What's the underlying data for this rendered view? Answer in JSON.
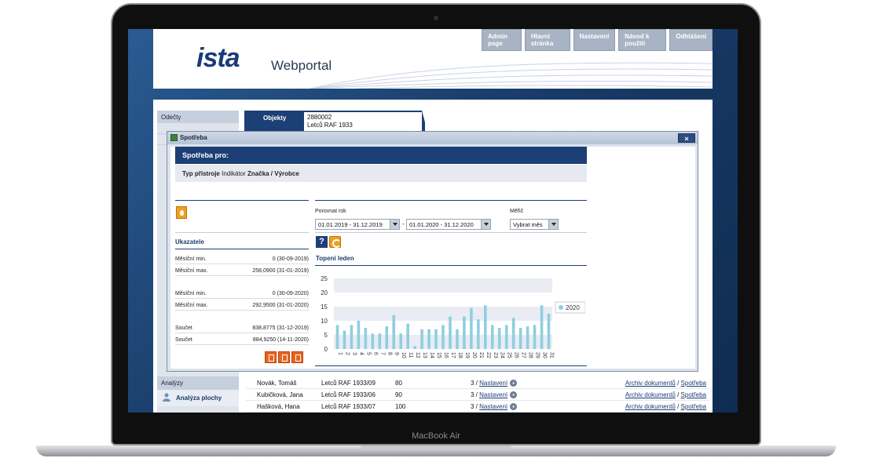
{
  "device": {
    "brand": "MacBook Air"
  },
  "header": {
    "logo_main": "ista",
    "app_title": "Webportal",
    "nav": [
      "Admin page",
      "Hlavní stránka",
      "Nastavení",
      "Návod k použití",
      "Odhlášení"
    ]
  },
  "sidebar": {
    "title": "Odečty",
    "section_analyzy": "Analýzy",
    "analyza_plochy": "Analýza plochy"
  },
  "objekty": {
    "label": "Objekty",
    "id": "2880002",
    "address": "Letců RAF 1933"
  },
  "bg_table": {
    "rows": [
      {
        "name": "Novák, Tomáš",
        "object": "Letců RAF 1933/09",
        "num": "80",
        "count": "3 / ",
        "settings": "Nastavení",
        "docs": "Archiv dokumentů",
        "sep": " / ",
        "usage": "Spotřeba"
      },
      {
        "name": "Kubičková, Jana",
        "object": "Letců RAF 1933/06",
        "num": "90",
        "count": "3 / ",
        "settings": "Nastavení",
        "docs": "Archiv dokumentů",
        "sep": " / ",
        "usage": "Spotřeba"
      },
      {
        "name": "Hašková, Hana",
        "object": "Letců RAF 1933/07",
        "num": "100",
        "count": "3 / ",
        "settings": "Nastavení",
        "docs": "Archiv dokumentů",
        "sep": " / ",
        "usage": "Spotřeba"
      }
    ]
  },
  "modal": {
    "title": "Spotřeba",
    "close": "×",
    "heading": "Spotřeba pro:",
    "type_label": "Typ přístroje",
    "type_value": "Indikátor",
    "brand_label": "Značka / Výrobce",
    "stats_title": "Ukazatele",
    "stats": [
      {
        "label": "Měsíční min.",
        "value": "0 (30-09-2019)"
      },
      {
        "label": "Měsíční max.",
        "value": "258,0900 (31-01-2019)"
      },
      {
        "label": "Měsíční min.",
        "value": "0 (30-09-2020)"
      },
      {
        "label": "Měsíční max.",
        "value": "292,9500 (31-01-2020)"
      },
      {
        "label": "Součet",
        "value": "838,8775 (31-12-2019)"
      },
      {
        "label": "Součet",
        "value": "884,9250 (14-11-2020)"
      }
    ],
    "compare_label": "Porovnat rok",
    "range1": "01.01.2019 - 31.12.2019",
    "range2": "01.01.2020 - 31.12.2020",
    "range_sep": "-",
    "meter_label": "Měřič",
    "meter_value": "Vybrat měs",
    "help": "?",
    "chart_title": "Topení leden"
  },
  "chart_data": {
    "type": "bar",
    "title": "Topení leden",
    "categories": [
      "1",
      "2",
      "3",
      "4",
      "5",
      "6",
      "7",
      "8",
      "9",
      "10",
      "11",
      "12",
      "13",
      "14",
      "15",
      "16",
      "17",
      "18",
      "19",
      "20",
      "21",
      "22",
      "23",
      "24",
      "25",
      "26",
      "27",
      "28",
      "29",
      "30",
      "31"
    ],
    "series": [
      {
        "name": "2020",
        "values": [
          8.5,
          6.5,
          8.5,
          10,
          7.5,
          5.5,
          5.5,
          8,
          12,
          5.5,
          9,
          1,
          7,
          7,
          7,
          8.5,
          11.5,
          7,
          11.5,
          14.5,
          10.5,
          15.5,
          8.5,
          7.5,
          8.5,
          11,
          7.5,
          8,
          8.5,
          15.5,
          12.5
        ]
      }
    ],
    "ylim": [
      0,
      25
    ],
    "yticks": [
      0,
      5,
      10,
      15,
      20,
      25
    ],
    "color": "#8ecfe0",
    "legend": "right"
  }
}
